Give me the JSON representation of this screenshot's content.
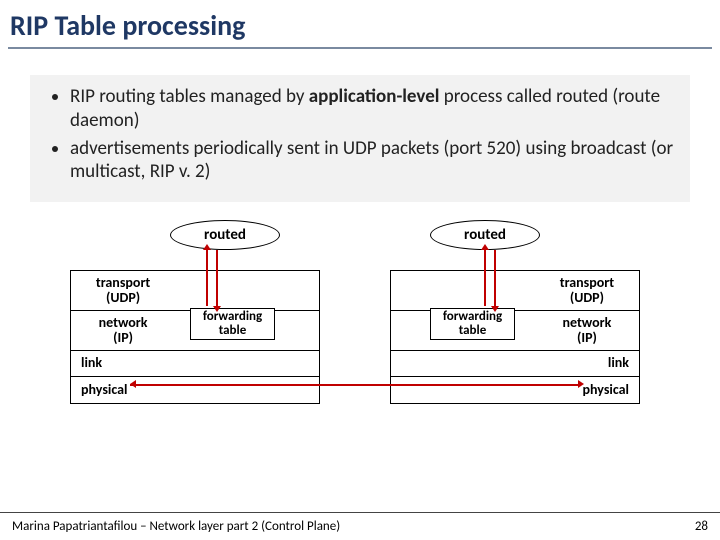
{
  "title": "RIP Table processing",
  "bullets": [
    {
      "pre": "RIP routing tables managed by ",
      "bold": "application-level",
      "post": " process called routed (route daemon)"
    },
    {
      "pre": "advertisements periodically sent in UDP packets (port 520) using broadcast (or multicast, RIP v. 2)",
      "bold": "",
      "post": ""
    }
  ],
  "diagram": {
    "ellipse_left": "routed",
    "ellipse_right": "routed",
    "left_stack": {
      "transport_l1": "transport",
      "transport_l2": "(UDP)",
      "network_l1": "network",
      "network_l2": "(IP)",
      "link": "link",
      "physical": "physical"
    },
    "right_stack": {
      "transport_l1": "transport",
      "transport_l2": "(UDP)",
      "network_l1": "network",
      "network_l2": "(IP)",
      "link": "link",
      "physical": "physical"
    },
    "fwd_left_l1": "forwarding",
    "fwd_left_l2": "table",
    "fwd_right_l1": "forwarding",
    "fwd_right_l2": "table"
  },
  "footer": {
    "text": "Marina Papatriantafilou –  Network layer part 2 (Control Plane)",
    "page": "28"
  }
}
